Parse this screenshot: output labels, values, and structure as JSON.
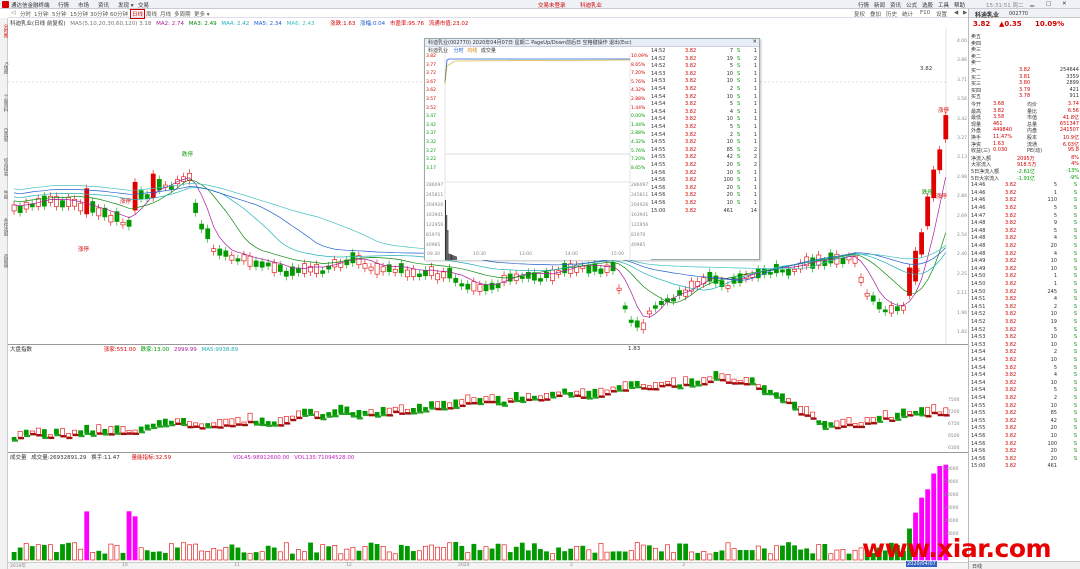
{
  "app": {
    "title": "通达信金融终端",
    "menus": [
      "行情",
      "市场",
      "资讯",
      "发现 ▾",
      "交易"
    ],
    "top_right": [
      "行情",
      "新闻",
      "资讯",
      "公式",
      "选股",
      "工具",
      "帮助"
    ],
    "time": "15:31:51 周二",
    "ticker_text": "交易未登录",
    "ticker_stock": "科迪乳业"
  },
  "toolbar": {
    "periods": [
      "分时",
      "1分钟",
      "5分钟",
      "15分钟",
      "30分钟",
      "60分钟",
      "日线",
      "周线",
      "月线",
      "多周期",
      "更多 ▾"
    ],
    "selected": "日线",
    "right_buttons": [
      "复权",
      "叠加",
      "历史",
      "统计",
      "F10",
      "设置"
    ]
  },
  "left_tabs": [
    "分时图",
    "K线图",
    "个股资料",
    "自选股",
    "综合排名",
    "牛股",
    "条件选股",
    "选股器"
  ],
  "main_chart": {
    "title": "科迪乳业(日线 前复权)",
    "ma": [
      {
        "label": "MA5",
        "value": "3.18",
        "color": "#777777"
      },
      {
        "label": "MA2",
        "value": "2.74",
        "color": "#a61e9c"
      },
      {
        "label": "MA3",
        "value": "2.49",
        "color": "#0a8a0a"
      },
      {
        "label": "MA4",
        "value": "2.42",
        "color": "#1fb1b8"
      },
      {
        "label": "MA5",
        "value": "2.34",
        "color": "#2060d0"
      },
      {
        "label": "MA6",
        "value": "2.43",
        "color": "#40c0c0"
      }
    ],
    "info_pieces": [
      {
        "label": "涨跌:",
        "value": "1.63"
      },
      {
        "label": "涨幅:",
        "value": "0.04"
      },
      {
        "label": "市盈率:",
        "value": "95.76"
      },
      {
        "label": "流通市值:",
        "value": "23.02"
      }
    ],
    "price_ticks": [
      "4.00",
      "3.86",
      "3.71",
      "3.56",
      "3.42",
      "3.27",
      "3.13",
      "2.98",
      "2.84",
      "2.69",
      "2.54",
      "2.40",
      "2.25",
      "2.11",
      "1.96",
      "1.82"
    ],
    "annotations": [
      "涨停",
      "涨停",
      "跌停",
      "涨停",
      "跌停",
      "涨停",
      "涨停"
    ],
    "low_label": "1.83",
    "high_label": "3.82",
    "markers": [
      "分笔",
      "分钟",
      "均线"
    ]
  },
  "index_chart": {
    "title": "大盘指数",
    "values": [
      {
        "label": "涨家:",
        "value": "551.00"
      },
      {
        "label": "跌家:",
        "value": "13.00"
      },
      {
        "label": "",
        "value": "2999.99"
      },
      {
        "label": "MA5:",
        "value": "9938.89"
      }
    ],
    "ticks": [
      "7500",
      "7200",
      "6750",
      "6500",
      "6300"
    ]
  },
  "volume_chart": {
    "title": "成交量",
    "pieces": [
      {
        "label": "成交量:",
        "value": "26932891.29"
      },
      {
        "label": "换手:",
        "value": "11.47"
      },
      {
        "label": "量能指标:",
        "value": "32.59"
      },
      {
        "label": "VOL45:",
        "value": "98912600.00"
      },
      {
        "label": "VOL135:",
        "value": "71094528.00"
      }
    ],
    "ticks": [
      "60000",
      "50000",
      "40000",
      "30000",
      "20000",
      "10000"
    ],
    "date_label": "2020/04/07",
    "x_labels": [
      "2019年",
      "10",
      "11",
      "12",
      "2020",
      "2",
      "3"
    ]
  },
  "popup": {
    "title": "科迪乳业(002770) 2020年04月07日 星期二 PageUp/Down前后日 空格键操作 退出(Esc)",
    "tabs": [
      "科迪乳业",
      "分时",
      "均线",
      "成交量"
    ],
    "price_ticks": [
      "3.82",
      "3.77",
      "3.72",
      "3.67",
      "3.62",
      "3.57",
      "3.52",
      "3.47",
      "3.42",
      "3.37",
      "3.32",
      "3.27",
      "3.22",
      "3.17"
    ],
    "pct_ticks": [
      "10.09%",
      "8.65%",
      "7.20%",
      "5.76%",
      "4.32%",
      "2.88%",
      "1.44%",
      "0.00%",
      "1.44%",
      "2.88%",
      "4.32%",
      "5.76%",
      "7.20%",
      "8.65%"
    ],
    "vol_ticks": [
      "286097",
      "245811",
      "204926",
      "163941",
      "122956",
      "81970",
      "40985"
    ],
    "x_ticks": [
      "09:30",
      "10:30",
      "13:00",
      "14:00",
      "15:00"
    ],
    "ticks_list": [
      {
        "t": "14:52",
        "p": "3.82",
        "v": "7",
        "s": "S",
        "n": "1"
      },
      {
        "t": "14:52",
        "p": "3.82",
        "v": "19",
        "s": "S",
        "n": "2"
      },
      {
        "t": "14:52",
        "p": "3.82",
        "v": "5",
        "s": "S",
        "n": "1"
      },
      {
        "t": "14:53",
        "p": "3.82",
        "v": "10",
        "s": "S",
        "n": "1"
      },
      {
        "t": "14:53",
        "p": "3.82",
        "v": "10",
        "s": "S",
        "n": "1"
      },
      {
        "t": "14:54",
        "p": "3.82",
        "v": "2",
        "s": "S",
        "n": "1"
      },
      {
        "t": "14:54",
        "p": "3.82",
        "v": "10",
        "s": "S",
        "n": "1"
      },
      {
        "t": "14:54",
        "p": "3.82",
        "v": "5",
        "s": "S",
        "n": "1"
      },
      {
        "t": "14:54",
        "p": "3.82",
        "v": "4",
        "s": "S",
        "n": "1"
      },
      {
        "t": "14:54",
        "p": "3.82",
        "v": "10",
        "s": "S",
        "n": "1"
      },
      {
        "t": "14:54",
        "p": "3.82",
        "v": "5",
        "s": "S",
        "n": "1"
      },
      {
        "t": "14:54",
        "p": "3.82",
        "v": "2",
        "s": "S",
        "n": "1"
      },
      {
        "t": "14:55",
        "p": "3.82",
        "v": "10",
        "s": "S",
        "n": "1"
      },
      {
        "t": "14:55",
        "p": "3.82",
        "v": "85",
        "s": "S",
        "n": "2"
      },
      {
        "t": "14:55",
        "p": "3.82",
        "v": "42",
        "s": "S",
        "n": "2"
      },
      {
        "t": "14:55",
        "p": "3.82",
        "v": "20",
        "s": "S",
        "n": "2"
      },
      {
        "t": "14:56",
        "p": "3.82",
        "v": "10",
        "s": "S",
        "n": "1"
      },
      {
        "t": "14:56",
        "p": "3.82",
        "v": "100",
        "s": "S",
        "n": "1"
      },
      {
        "t": "14:56",
        "p": "3.82",
        "v": "20",
        "s": "S",
        "n": "1"
      },
      {
        "t": "14:56",
        "p": "3.82",
        "v": "20",
        "s": "S",
        "n": "1"
      },
      {
        "t": "14:56",
        "p": "3.82",
        "v": "10",
        "s": "S",
        "n": "1"
      },
      {
        "t": "15:00",
        "p": "3.82",
        "v": "461",
        "s": "",
        "n": "14"
      }
    ]
  },
  "quote": {
    "name": "科迪乳业",
    "code": "002770",
    "price": "3.82",
    "change": "▲0.35",
    "pct": "10.09%",
    "asks": [
      {
        "label": "卖五",
        "price": "",
        "vol": ""
      },
      {
        "label": "卖四",
        "price": "",
        "vol": ""
      },
      {
        "label": "卖三",
        "price": "",
        "vol": ""
      },
      {
        "label": "卖二",
        "price": "",
        "vol": ""
      },
      {
        "label": "卖一",
        "price": "",
        "vol": ""
      }
    ],
    "bids": [
      {
        "label": "买一",
        "price": "3.82",
        "vol": "254644"
      },
      {
        "label": "买二",
        "price": "3.81",
        "vol": "3359"
      },
      {
        "label": "买三",
        "price": "3.80",
        "vol": "2899"
      },
      {
        "label": "买四",
        "price": "3.79",
        "vol": "421"
      },
      {
        "label": "买五",
        "price": "3.78",
        "vol": "911"
      }
    ],
    "stats": [
      {
        "l1": "今开",
        "v1": "3.68",
        "l2": "均价",
        "v2": "3.74"
      },
      {
        "l1": "最高",
        "v1": "3.82",
        "l2": "量比",
        "v2": "6.56"
      },
      {
        "l1": "最低",
        "v1": "3.58",
        "l2": "市值",
        "v2": "41.8亿"
      },
      {
        "l1": "现量",
        "v1": "461",
        "l2": "总量",
        "v2": "651347"
      },
      {
        "l1": "外盘",
        "v1": "449840",
        "l2": "内盘",
        "v2": "241507"
      },
      {
        "l1": "换手",
        "v1": "11.47%",
        "l2": "股本",
        "v2": "10.9亿"
      },
      {
        "l1": "净资",
        "v1": "1.63",
        "l2": "流通",
        "v2": "6.03亿"
      },
      {
        "l1": "收益(三)",
        "v1": "0.030",
        "l2": "PE(动)",
        "v2": "95.8"
      }
    ],
    "flows": [
      {
        "label": "净流入额",
        "v1": "2095万",
        "v2": "8%"
      },
      {
        "label": "大宗流入",
        "v1": "918.5万",
        "v2": "4%"
      },
      {
        "label": "5日净流入额",
        "v1": "-2.61亿",
        "v2": "-13%"
      },
      {
        "label": "5日大宗流入",
        "v1": "-1.91亿",
        "v2": "-9%"
      }
    ],
    "ticks": [
      {
        "t": "14:46",
        "p": "3.82",
        "v": "5",
        "s": "S"
      },
      {
        "t": "14:46",
        "p": "3.82",
        "v": "1",
        "s": "S"
      },
      {
        "t": "14:46",
        "p": "3.82",
        "v": "110",
        "s": "S"
      },
      {
        "t": "14:46",
        "p": "3.82",
        "v": "5",
        "s": "S"
      },
      {
        "t": "14:47",
        "p": "3.82",
        "v": "5",
        "s": "S"
      },
      {
        "t": "14:48",
        "p": "3.82",
        "v": "9",
        "s": "S"
      },
      {
        "t": "14:48",
        "p": "3.82",
        "v": "5",
        "s": "S"
      },
      {
        "t": "14:48",
        "p": "3.82",
        "v": "4",
        "s": "S"
      },
      {
        "t": "14:48",
        "p": "3.82",
        "v": "20",
        "s": "S"
      },
      {
        "t": "14:48",
        "p": "3.82",
        "v": "4",
        "s": "S"
      },
      {
        "t": "14:49",
        "p": "3.82",
        "v": "10",
        "s": "S"
      },
      {
        "t": "14:49",
        "p": "3.82",
        "v": "10",
        "s": "S"
      },
      {
        "t": "14:50",
        "p": "3.82",
        "v": "1",
        "s": "S"
      },
      {
        "t": "14:50",
        "p": "3.82",
        "v": "1",
        "s": "S"
      },
      {
        "t": "14:50",
        "p": "3.82",
        "v": "245",
        "s": "S"
      },
      {
        "t": "14:51",
        "p": "3.82",
        "v": "4",
        "s": "S"
      },
      {
        "t": "14:51",
        "p": "3.82",
        "v": "2",
        "s": "S"
      },
      {
        "t": "14:52",
        "p": "3.82",
        "v": "10",
        "s": "S"
      },
      {
        "t": "14:52",
        "p": "3.82",
        "v": "19",
        "s": "S"
      },
      {
        "t": "14:52",
        "p": "3.82",
        "v": "5",
        "s": "S"
      },
      {
        "t": "14:53",
        "p": "3.82",
        "v": "10",
        "s": "S"
      },
      {
        "t": "14:53",
        "p": "3.82",
        "v": "10",
        "s": "S"
      },
      {
        "t": "14:54",
        "p": "3.82",
        "v": "2",
        "s": "S"
      },
      {
        "t": "14:54",
        "p": "3.82",
        "v": "10",
        "s": "S"
      },
      {
        "t": "14:54",
        "p": "3.82",
        "v": "5",
        "s": "S"
      },
      {
        "t": "14:54",
        "p": "3.82",
        "v": "4",
        "s": "S"
      },
      {
        "t": "14:54",
        "p": "3.82",
        "v": "10",
        "s": "S"
      },
      {
        "t": "14:54",
        "p": "3.82",
        "v": "5",
        "s": "S"
      },
      {
        "t": "14:54",
        "p": "3.82",
        "v": "2",
        "s": "S"
      },
      {
        "t": "14:55",
        "p": "3.82",
        "v": "10",
        "s": "S"
      },
      {
        "t": "14:55",
        "p": "3.82",
        "v": "85",
        "s": "S"
      },
      {
        "t": "14:55",
        "p": "3.82",
        "v": "42",
        "s": "S"
      },
      {
        "t": "14:55",
        "p": "3.82",
        "v": "20",
        "s": "S"
      },
      {
        "t": "14:56",
        "p": "3.82",
        "v": "10",
        "s": "S"
      },
      {
        "t": "14:56",
        "p": "3.82",
        "v": "100",
        "s": "S"
      },
      {
        "t": "14:56",
        "p": "3.82",
        "v": "20",
        "s": "S"
      },
      {
        "t": "14:56",
        "p": "3.82",
        "v": "20",
        "s": "S"
      },
      {
        "t": "15:00",
        "p": "3.82",
        "v": "461",
        "s": ""
      }
    ],
    "bottom_tab": "日线"
  },
  "watermark": "www.xiar.com",
  "colors": {
    "up": "#e00000",
    "down": "#009a00",
    "accent": "#d40000"
  }
}
